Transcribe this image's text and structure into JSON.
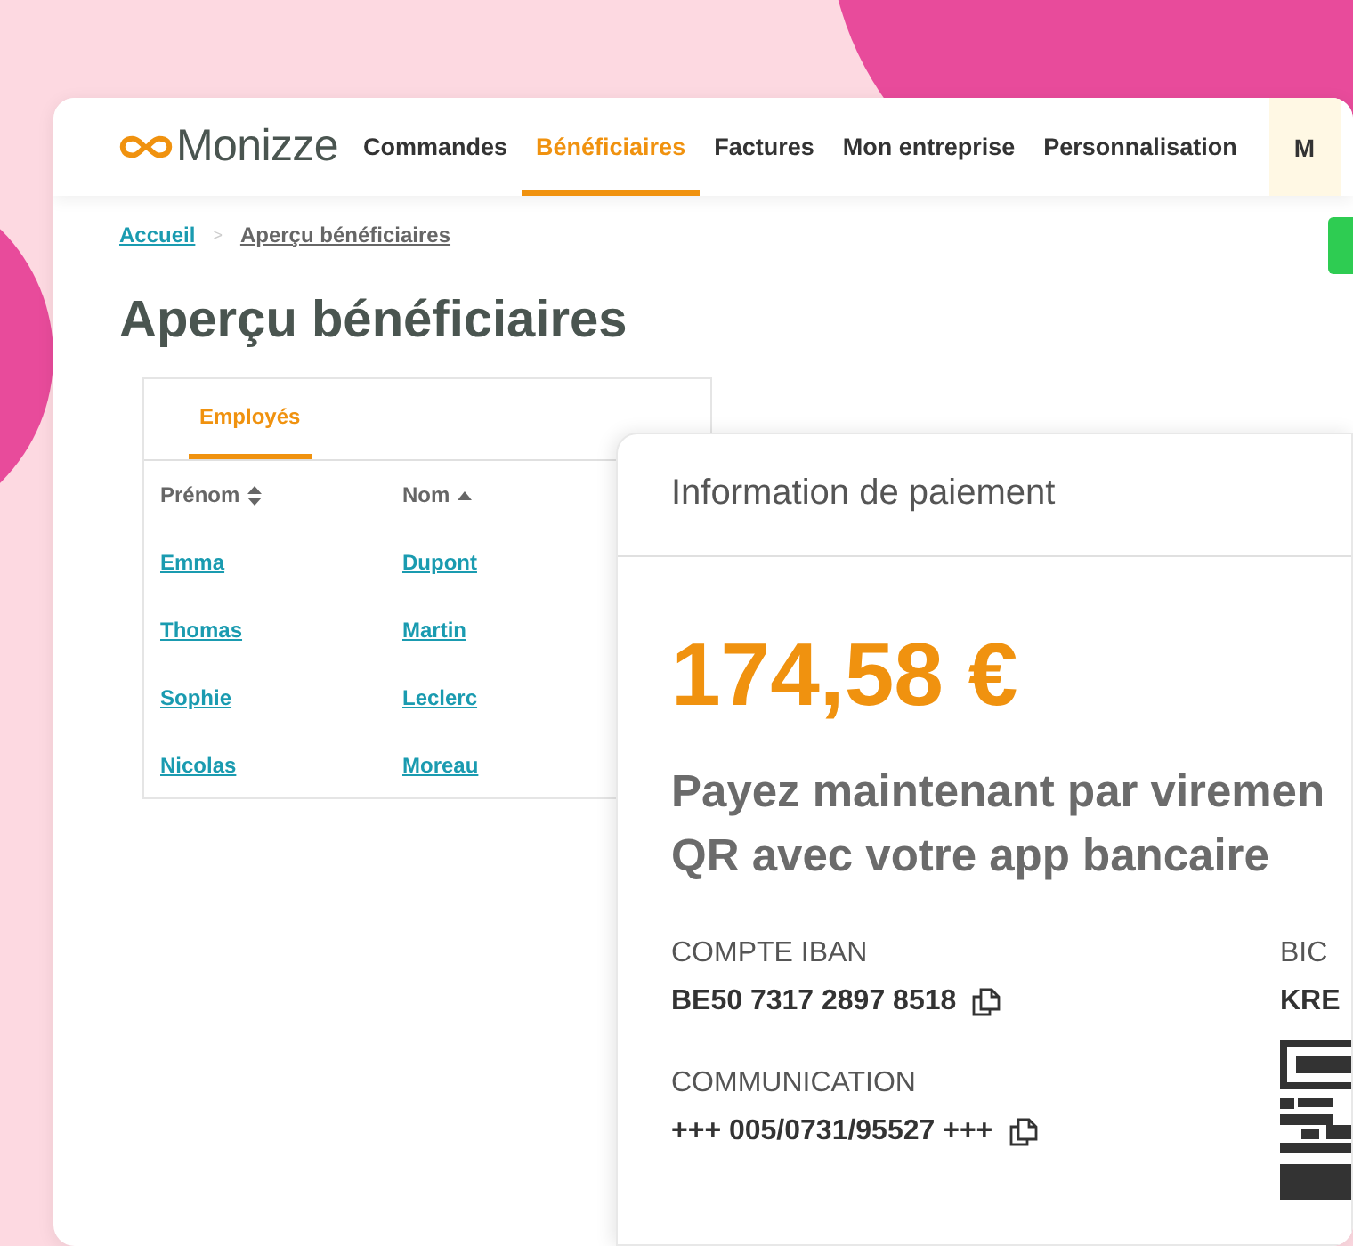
{
  "nav": {
    "logo": "Monizze",
    "items": [
      {
        "label": "Commandes",
        "selected": false
      },
      {
        "label": "Bénéficiaires",
        "selected": true
      },
      {
        "label": "Factures",
        "selected": false
      },
      {
        "label": "Mon entreprise",
        "selected": false
      },
      {
        "label": "Personnalisation",
        "selected": false
      }
    ],
    "account": "M"
  },
  "breadcrumb_separator": ">",
  "breadcrumb": [
    {
      "label": "Accueil",
      "current": false
    },
    {
      "label": "Aperçu bénéficiaires",
      "current": true
    }
  ],
  "page_title": "Aperçu bénéficiaires",
  "table": {
    "tabs": [
      {
        "label": "Employés",
        "selected": true
      }
    ],
    "columns": [
      {
        "label": "Prénom",
        "sorted": false
      },
      {
        "label": "Nom",
        "sorted": true
      }
    ],
    "rows": [
      [
        "Emma",
        "Dupont"
      ],
      [
        "Thomas",
        "Martin"
      ],
      [
        "Sophie",
        "Leclerc"
      ],
      [
        "Nicolas",
        "Moreau"
      ]
    ]
  },
  "payment": {
    "title": "Information de paiement",
    "amount": "174,58 €",
    "instruction_lines": [
      "Payez maintenant par viremen",
      "QR avec votre app bancaire"
    ],
    "fields": [
      {
        "label": "COMPTE IBAN",
        "value": "BE50 7317 2897 8518",
        "copy": true
      },
      {
        "label": "COMMUNICATION",
        "value": "+++ 005/0731/95527 +++",
        "copy": true
      }
    ],
    "bic": {
      "label": "BIC",
      "value": "KRE"
    }
  }
}
